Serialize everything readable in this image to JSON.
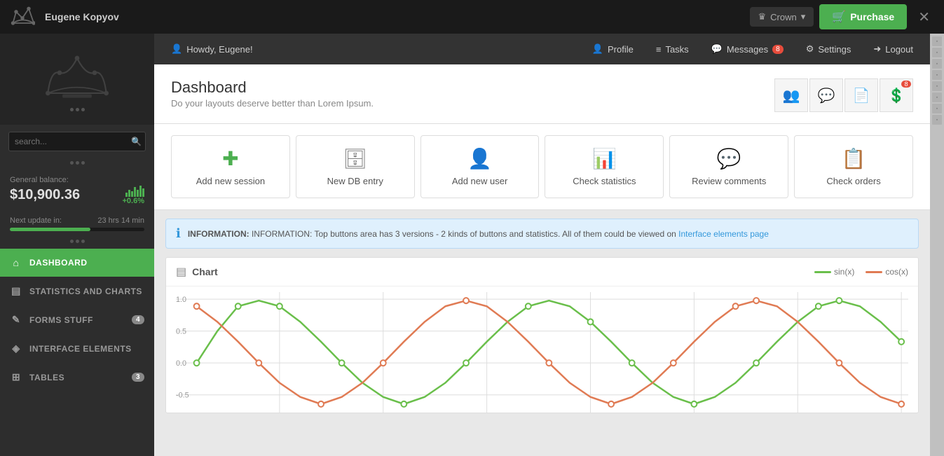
{
  "topbar": {
    "username": "Eugene Kopyov",
    "theme": "Crown",
    "purchase_label": "Purchase"
  },
  "subheader": {
    "greeting": "Howdy, Eugene!",
    "profile": "Profile",
    "tasks": "Tasks",
    "messages": "Messages",
    "messages_count": "8",
    "settings": "Settings",
    "logout": "Logout"
  },
  "sidebar": {
    "balance_label": "General balance:",
    "balance_amount": "$10,900.36",
    "balance_change": "+0.6%",
    "next_update_label": "Next update in:",
    "next_update_value": "23 hrs  14 min",
    "search_placeholder": "search...",
    "nav": [
      {
        "id": "dashboard",
        "label": "DASHBOARD",
        "icon": "⌂",
        "badge": null,
        "active": true
      },
      {
        "id": "statistics",
        "label": "STATISTICS AND CHARTS",
        "icon": "▤",
        "badge": null,
        "active": false
      },
      {
        "id": "forms",
        "label": "FORMS STUFF",
        "icon": "✎",
        "badge": "4",
        "active": false
      },
      {
        "id": "interface",
        "label": "INTERFACE ELEMENTS",
        "icon": "👤",
        "badge": null,
        "active": false
      },
      {
        "id": "tables",
        "label": "TABLES",
        "icon": "⊞",
        "badge": "3",
        "active": false
      }
    ]
  },
  "dashboard": {
    "title": "Dashboard",
    "subtitle": "Do your layouts deserve better than Lorem Ipsum.",
    "quick_actions": [
      {
        "id": "add-session",
        "label": "Add new session",
        "icon": "➕"
      },
      {
        "id": "new-db",
        "label": "New DB entry",
        "icon": "🗄"
      },
      {
        "id": "add-user",
        "label": "Add new user",
        "icon": "👤"
      },
      {
        "id": "check-stats",
        "label": "Check statistics",
        "icon": "📊"
      },
      {
        "id": "review-comments",
        "label": "Review comments",
        "icon": "💬"
      },
      {
        "id": "check-orders",
        "label": "Check orders",
        "icon": "📋"
      }
    ],
    "info_text": "INFORMATION:  Top buttons area has 3 versions - 2 kinds of buttons and statistics. All of them could be viewed on ",
    "info_link": "Interface elements page",
    "chart_title": "Chart",
    "legend_sin": "sin(x)",
    "legend_cos": "cos(x)",
    "chart_badge": "8"
  }
}
